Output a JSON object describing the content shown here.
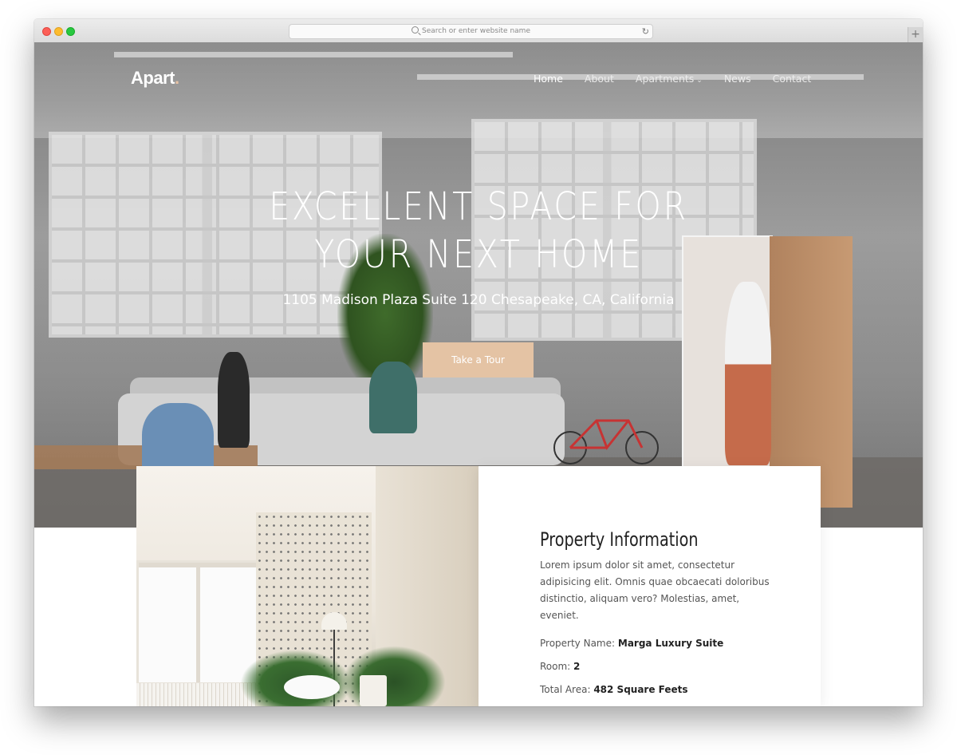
{
  "browser": {
    "url_placeholder": "Search or enter website name",
    "new_tab_label": "+"
  },
  "brand": {
    "name": "Apart",
    "dot": "."
  },
  "nav": {
    "items": [
      {
        "label": "Home"
      },
      {
        "label": "About"
      },
      {
        "label": "Apartments"
      },
      {
        "label": "News"
      },
      {
        "label": "Contact"
      }
    ],
    "active": "Home"
  },
  "hero": {
    "title_line1": "EXCELLENT SPACE FOR",
    "title_line2": "YOUR NEXT HOME",
    "address": "1105 Madison Plaza Suite 120 Chesapeake, CA, California",
    "cta": "Take a Tour"
  },
  "property": {
    "title": "Property Information",
    "description": "Lorem ipsum dolor sit amet, consectetur adipisicing elit. Omnis quae obcaecati doloribus distinctio, aliquam vero? Molestias, amet, eveniet.",
    "name_label": "Property Name:",
    "name_value": "Marga Luxury Suite",
    "room_label": "Room:",
    "room_value": "2",
    "area_label": "Total Area:",
    "area_value": "482 Square Feets"
  },
  "colors": {
    "accent": "#e4c3a4",
    "text_dark": "#222222",
    "text_muted": "#555555"
  }
}
